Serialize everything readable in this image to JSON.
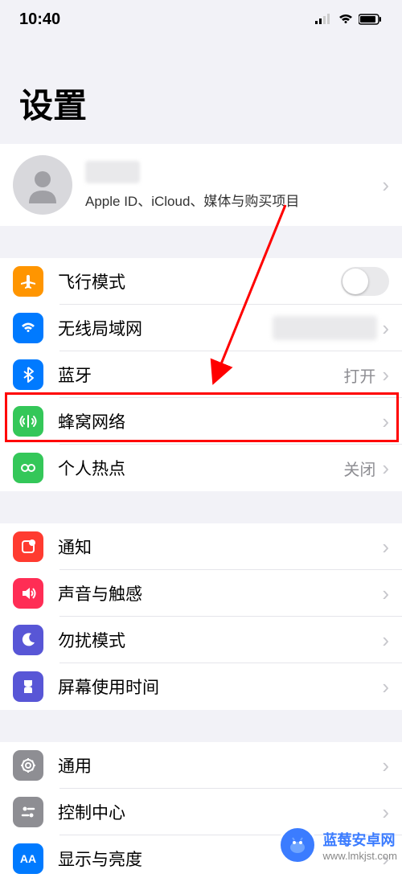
{
  "status": {
    "time": "10:40"
  },
  "title": "设置",
  "profile": {
    "subtitle": "Apple ID、iCloud、媒体与购买项目"
  },
  "groups": [
    {
      "rows": [
        {
          "icon": "airplane",
          "color": "#ff9500",
          "label": "飞行模式",
          "accessory": "toggle"
        },
        {
          "icon": "wifi",
          "color": "#007aff",
          "label": "无线局域网",
          "accessory": "blur-chevron"
        },
        {
          "icon": "bluetooth",
          "color": "#007aff",
          "label": "蓝牙",
          "value": "打开",
          "accessory": "value-chevron"
        },
        {
          "icon": "cellular",
          "color": "#34c759",
          "label": "蜂窝网络",
          "accessory": "chevron"
        },
        {
          "icon": "hotspot",
          "color": "#34c759",
          "label": "个人热点",
          "value": "关闭",
          "accessory": "value-chevron"
        }
      ]
    },
    {
      "rows": [
        {
          "icon": "notification",
          "color": "#ff3b30",
          "label": "通知",
          "accessory": "chevron"
        },
        {
          "icon": "sound",
          "color": "#ff2d55",
          "label": "声音与触感",
          "accessory": "chevron"
        },
        {
          "icon": "dnd",
          "color": "#5856d6",
          "label": "勿扰模式",
          "accessory": "chevron"
        },
        {
          "icon": "screentime",
          "color": "#5856d6",
          "label": "屏幕使用时间",
          "accessory": "chevron"
        }
      ]
    },
    {
      "rows": [
        {
          "icon": "general",
          "color": "#8e8e93",
          "label": "通用",
          "accessory": "chevron"
        },
        {
          "icon": "control",
          "color": "#8e8e93",
          "label": "控制中心",
          "accessory": "chevron"
        },
        {
          "icon": "display",
          "color": "#007aff",
          "label": "显示与亮度",
          "accessory": "chevron"
        }
      ]
    }
  ],
  "watermark": {
    "line1": "蓝莓安卓网",
    "line2": "www.lmkjst.com"
  }
}
